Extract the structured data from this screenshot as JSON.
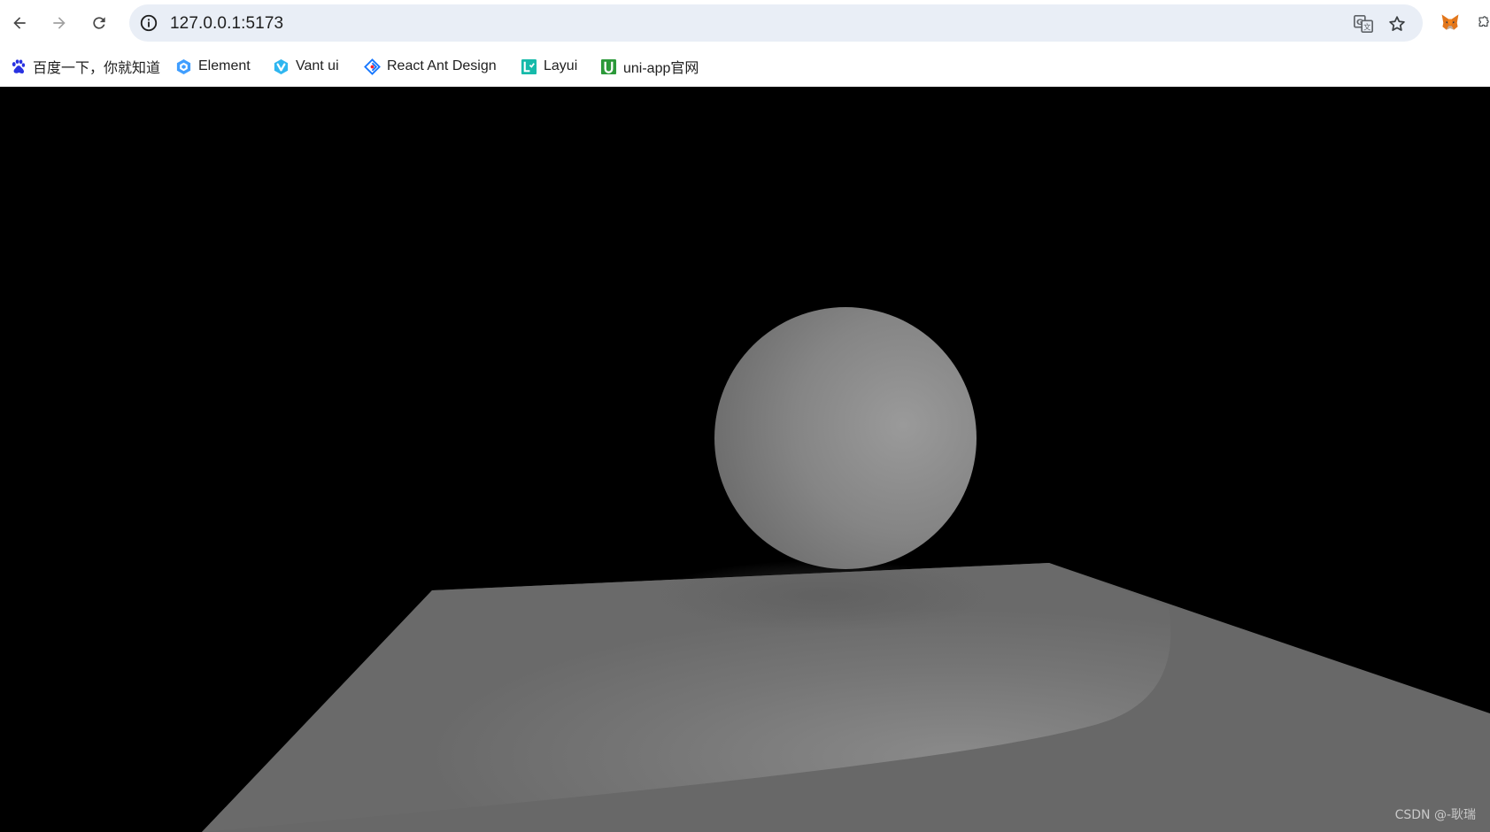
{
  "browser": {
    "url": "127.0.0.1:5173",
    "icons": {
      "back": "back-arrow-icon",
      "forward": "forward-arrow-icon",
      "reload": "reload-icon",
      "site_info": "info-icon",
      "translate": "translate-icon",
      "bookmark_star": "star-icon",
      "extension": "metamask-fox-icon",
      "puzzle": "extensions-icon"
    }
  },
  "bookmarks": [
    {
      "label": "百度一下，你就知道",
      "icon": "baidu-paw-icon",
      "color": "#2932e1"
    },
    {
      "label": "Element",
      "icon": "element-hex-icon",
      "color": "#409eff"
    },
    {
      "label": "Vant ui",
      "icon": "vant-icon",
      "color": "#1989fa"
    },
    {
      "label": "React Ant Design",
      "icon": "ant-design-icon",
      "color": "#1677ff"
    },
    {
      "label": "Layui",
      "icon": "layui-icon",
      "color": "#16baaa"
    },
    {
      "label": "uni-app官网",
      "icon": "uniapp-icon",
      "color": "#2b9939"
    }
  ],
  "canvas": {
    "background": "#000000",
    "sphere_color": "#8a8a8a",
    "plane_color": "#686868"
  },
  "watermark": "CSDN @-耿瑞"
}
